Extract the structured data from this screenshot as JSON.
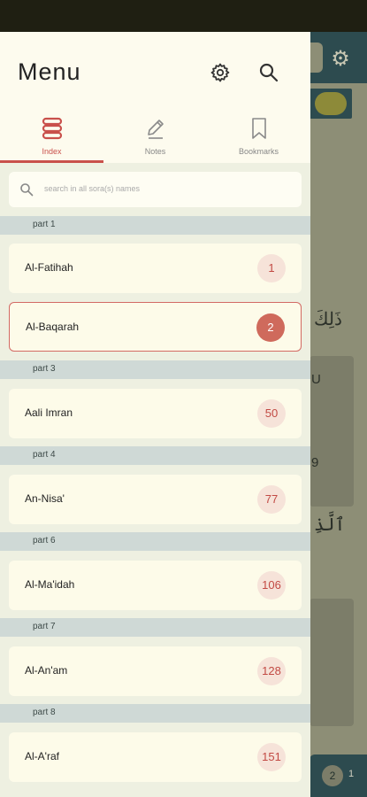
{
  "colors": {
    "accent": "#c9504b",
    "drawer_bg": "#fbf8e7",
    "part_header_bg": "#cfd9d6",
    "badge_bg": "#f6e3d9"
  },
  "menu": {
    "title": "Menu",
    "settings_icon": "gear-icon",
    "search_icon": "search-icon"
  },
  "tabs": [
    {
      "label": "Index",
      "icon": "stack-icon",
      "active": true
    },
    {
      "label": "Notes",
      "icon": "pencil-icon",
      "active": false
    },
    {
      "label": "Bookmarks",
      "icon": "bookmark-icon",
      "active": false
    }
  ],
  "search": {
    "placeholder": "search in all sora(s) names"
  },
  "parts": [
    {
      "label": "part 1",
      "suras": [
        {
          "name": "Al-Fatihah",
          "number": "1",
          "selected": false
        },
        {
          "name": "Al-Baqarah",
          "number": "2",
          "selected": true
        }
      ]
    },
    {
      "label": "part 3",
      "suras": [
        {
          "name": "Aali Imran",
          "number": "50",
          "selected": false
        }
      ]
    },
    {
      "label": "part 4",
      "suras": [
        {
          "name": "An-Nisa'",
          "number": "77",
          "selected": false
        }
      ]
    },
    {
      "label": "part 6",
      "suras": [
        {
          "name": "Al-Ma'idah",
          "number": "106",
          "selected": false
        }
      ]
    },
    {
      "label": "part 7",
      "suras": [
        {
          "name": "Al-An'am",
          "number": "128",
          "selected": false
        }
      ]
    },
    {
      "label": "part 8",
      "suras": [
        {
          "name": "Al-A'raf",
          "number": "151",
          "selected": false
        }
      ]
    }
  ],
  "background": {
    "arabic_1": "ذَلِكَ",
    "arabic_2": "ٱلَّذِ",
    "text_1": "U",
    "text_2": "9",
    "page_badge": "2",
    "page_badge_text": "1"
  }
}
